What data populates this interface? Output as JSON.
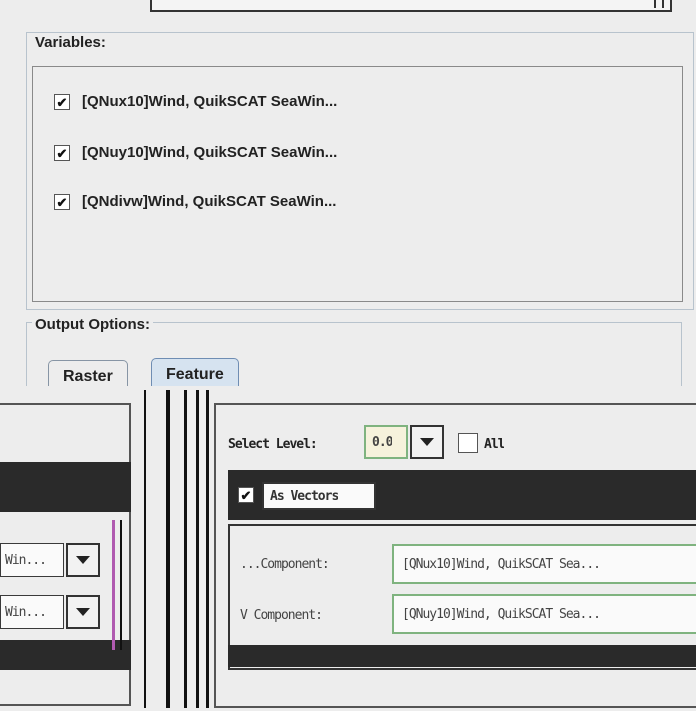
{
  "variables_panel": {
    "legend": "Variables:",
    "items": [
      {
        "label": "[QNux10]Wind, QuikSCAT SeaWin...",
        "checked": true
      },
      {
        "label": "[QNuy10]Wind, QuikSCAT SeaWin...",
        "checked": true
      },
      {
        "label": "[QNdivw]Wind, QuikSCAT SeaWin...",
        "checked": true
      }
    ]
  },
  "output_options": {
    "legend": "Output Options:",
    "tabs": [
      "Raster",
      "Feature"
    ],
    "active_tab": "Feature"
  },
  "check_mark": "✔",
  "glitch_area": {
    "select_level_label": "Select Level:",
    "level_value": "0.0",
    "all_label": "All",
    "as_vectors_label": "As Vectors",
    "component_rows": [
      {
        "label": "...Component:",
        "value": "[QNux10]Wind, QuikSCAT Sea..."
      },
      {
        "label": "V Component:",
        "value": "[QNuy10]Wind, QuikSCAT Sea..."
      }
    ],
    "left_fragments": [
      "Win...",
      "Win..."
    ]
  }
}
